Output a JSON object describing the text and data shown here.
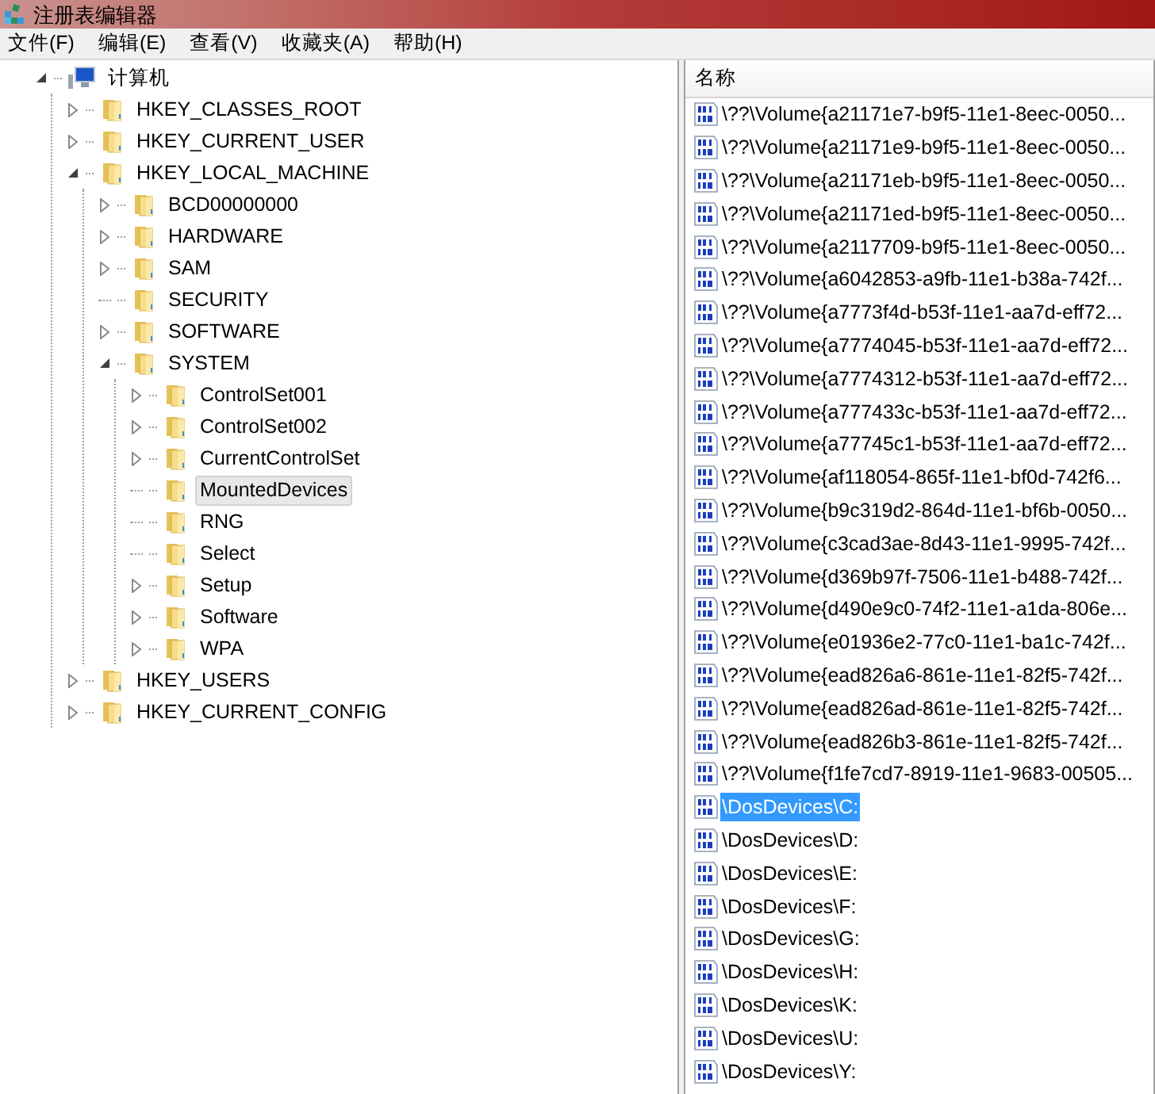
{
  "window": {
    "title": "注册表编辑器"
  },
  "menu": [
    "文件(F)",
    "编辑(E)",
    "查看(V)",
    "收藏夹(A)",
    "帮助(H)"
  ],
  "tree": {
    "label": "计算机",
    "kind": "computer",
    "expandable": true,
    "expanded": true,
    "selected": false,
    "children": [
      {
        "label": "HKEY_CLASSES_ROOT",
        "expandable": true,
        "expanded": false,
        "selected": false
      },
      {
        "label": "HKEY_CURRENT_USER",
        "expandable": true,
        "expanded": false,
        "selected": false
      },
      {
        "label": "HKEY_LOCAL_MACHINE",
        "expandable": true,
        "expanded": true,
        "selected": false,
        "children": [
          {
            "label": "BCD00000000",
            "expandable": true,
            "expanded": false,
            "selected": false
          },
          {
            "label": "HARDWARE",
            "expandable": true,
            "expanded": false,
            "selected": false
          },
          {
            "label": "SAM",
            "expandable": true,
            "expanded": false,
            "selected": false
          },
          {
            "label": "SECURITY",
            "expandable": false,
            "selected": false
          },
          {
            "label": "SOFTWARE",
            "expandable": true,
            "expanded": false,
            "selected": false
          },
          {
            "label": "SYSTEM",
            "expandable": true,
            "expanded": true,
            "selected": false,
            "children": [
              {
                "label": "ControlSet001",
                "expandable": true,
                "expanded": false,
                "selected": false
              },
              {
                "label": "ControlSet002",
                "expandable": true,
                "expanded": false,
                "selected": false
              },
              {
                "label": "CurrentControlSet",
                "expandable": true,
                "expanded": false,
                "selected": false
              },
              {
                "label": "MountedDevices",
                "expandable": false,
                "selected": true
              },
              {
                "label": "RNG",
                "expandable": false,
                "selected": false
              },
              {
                "label": "Select",
                "expandable": false,
                "selected": false
              },
              {
                "label": "Setup",
                "expandable": true,
                "expanded": false,
                "selected": false
              },
              {
                "label": "Software",
                "expandable": true,
                "expanded": false,
                "selected": false
              },
              {
                "label": "WPA",
                "expandable": true,
                "expanded": false,
                "selected": false
              }
            ]
          }
        ]
      },
      {
        "label": "HKEY_USERS",
        "expandable": true,
        "expanded": false,
        "selected": false
      },
      {
        "label": "HKEY_CURRENT_CONFIG",
        "expandable": true,
        "expanded": false,
        "selected": false
      }
    ]
  },
  "list": {
    "columns": [
      "名称"
    ],
    "rows": [
      {
        "name": "\\??\\Volume{a21171e7-b9f5-11e1-8eec-0050...",
        "selected": false
      },
      {
        "name": "\\??\\Volume{a21171e9-b9f5-11e1-8eec-0050...",
        "selected": false
      },
      {
        "name": "\\??\\Volume{a21171eb-b9f5-11e1-8eec-0050...",
        "selected": false
      },
      {
        "name": "\\??\\Volume{a21171ed-b9f5-11e1-8eec-0050...",
        "selected": false
      },
      {
        "name": "\\??\\Volume{a2117709-b9f5-11e1-8eec-0050...",
        "selected": false
      },
      {
        "name": "\\??\\Volume{a6042853-a9fb-11e1-b38a-742f...",
        "selected": false
      },
      {
        "name": "\\??\\Volume{a7773f4d-b53f-11e1-aa7d-eff72...",
        "selected": false
      },
      {
        "name": "\\??\\Volume{a7774045-b53f-11e1-aa7d-eff72...",
        "selected": false
      },
      {
        "name": "\\??\\Volume{a7774312-b53f-11e1-aa7d-eff72...",
        "selected": false
      },
      {
        "name": "\\??\\Volume{a777433c-b53f-11e1-aa7d-eff72...",
        "selected": false
      },
      {
        "name": "\\??\\Volume{a77745c1-b53f-11e1-aa7d-eff72...",
        "selected": false
      },
      {
        "name": "\\??\\Volume{af118054-865f-11e1-bf0d-742f6...",
        "selected": false
      },
      {
        "name": "\\??\\Volume{b9c319d2-864d-11e1-bf6b-0050...",
        "selected": false
      },
      {
        "name": "\\??\\Volume{c3cad3ae-8d43-11e1-9995-742f...",
        "selected": false
      },
      {
        "name": "\\??\\Volume{d369b97f-7506-11e1-b488-742f...",
        "selected": false
      },
      {
        "name": "\\??\\Volume{d490e9c0-74f2-11e1-a1da-806e...",
        "selected": false
      },
      {
        "name": "\\??\\Volume{e01936e2-77c0-11e1-ba1c-742f...",
        "selected": false
      },
      {
        "name": "\\??\\Volume{ead826a6-861e-11e1-82f5-742f...",
        "selected": false
      },
      {
        "name": "\\??\\Volume{ead826ad-861e-11e1-82f5-742f...",
        "selected": false
      },
      {
        "name": "\\??\\Volume{ead826b3-861e-11e1-82f5-742f...",
        "selected": false
      },
      {
        "name": "\\??\\Volume{f1fe7cd7-8919-11e1-9683-00505...",
        "selected": false
      },
      {
        "name": "\\DosDevices\\C:",
        "selected": true
      },
      {
        "name": "\\DosDevices\\D:",
        "selected": false
      },
      {
        "name": "\\DosDevices\\E:",
        "selected": false
      },
      {
        "name": "\\DosDevices\\F:",
        "selected": false
      },
      {
        "name": "\\DosDevices\\G:",
        "selected": false
      },
      {
        "name": "\\DosDevices\\H:",
        "selected": false
      },
      {
        "name": "\\DosDevices\\K:",
        "selected": false
      },
      {
        "name": "\\DosDevices\\U:",
        "selected": false
      },
      {
        "name": "\\DosDevices\\Y:",
        "selected": false
      }
    ]
  }
}
